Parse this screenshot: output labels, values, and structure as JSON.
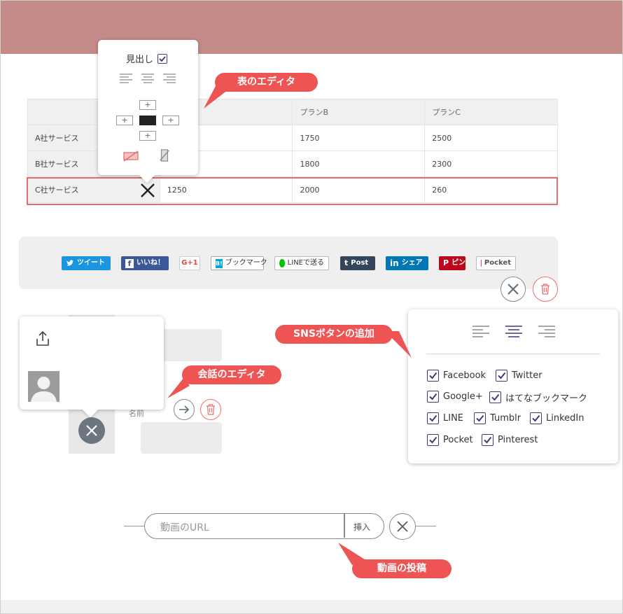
{
  "table": {
    "headers": [
      "",
      "",
      "プランB",
      "プランC"
    ],
    "rows": [
      {
        "label": "A社サービス",
        "cells": [
          "",
          "1750",
          "2500"
        ]
      },
      {
        "label": "B社サービス",
        "cells": [
          "",
          "1800",
          "2300"
        ]
      },
      {
        "label": "C社サービス",
        "cells": [
          "1250",
          "2000",
          "260"
        ]
      }
    ]
  },
  "table_editor": {
    "heading_label": "見出し",
    "heading_checked": true,
    "add_symbol": "+"
  },
  "callouts": {
    "table_editor": "表のエディタ",
    "sns_add": "SNSボタンの追加",
    "conversation_editor": "会話のエディタ",
    "video_post": "動画の投稿"
  },
  "sns_bar": {
    "buttons": [
      {
        "label": "ツイート",
        "color": "#1b95e0"
      },
      {
        "label": "いいね！",
        "color": "#3b5998"
      },
      {
        "label": "G+1",
        "color": "#ffffff"
      },
      {
        "label": "ブックマーク",
        "color": "#ffffff"
      },
      {
        "label": "LINEで送る",
        "color": "#ffffff"
      },
      {
        "label": "Post",
        "color": "#2d3e50"
      },
      {
        "label": "シェア",
        "color": "#0077b5"
      },
      {
        "label": "ピン",
        "color": "#bd081c"
      },
      {
        "label": "Pocket",
        "color": "#ffffff"
      }
    ]
  },
  "sns_editor": {
    "options": [
      {
        "label": "Facebook",
        "checked": true
      },
      {
        "label": "Twitter",
        "checked": true
      },
      {
        "label": "Google+",
        "checked": true
      },
      {
        "label": "はてなブックマーク",
        "checked": true
      },
      {
        "label": "LINE",
        "checked": true
      },
      {
        "label": "Tumblr",
        "checked": true
      },
      {
        "label": "LinkedIn",
        "checked": true
      },
      {
        "label": "Pocket",
        "checked": true
      },
      {
        "label": "Pinterest",
        "checked": true
      }
    ]
  },
  "conversation": {
    "name_label": "名前"
  },
  "video": {
    "placeholder": "動画のURL",
    "insert_label": "挿入"
  },
  "colors": {
    "accent_red": "#ef5454",
    "header": "#c48b89",
    "check": "#3f3a78"
  }
}
